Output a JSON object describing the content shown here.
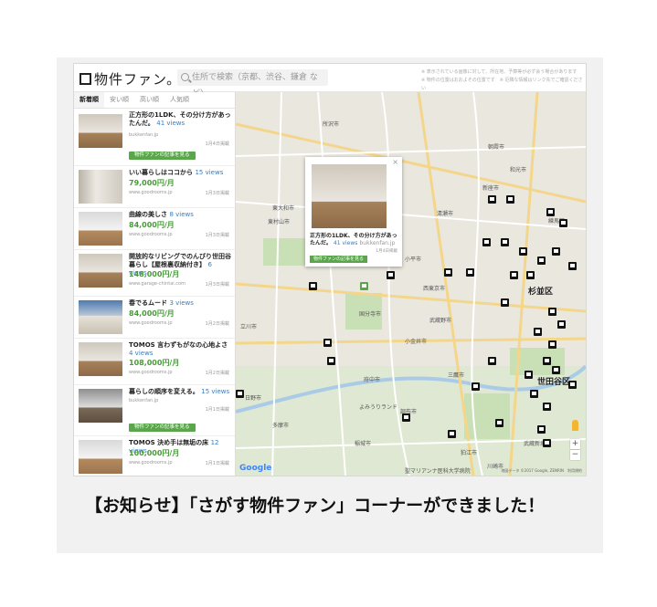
{
  "app": {
    "logo_text": "物件ファン。",
    "search_placeholder": "住所で検索（京都、渋谷、鎌倉 など）",
    "notes": [
      "※ 表示されている画像に対して、所在地、予算等が必ず会う場合があります",
      "※ 物件の位置はおおよその位置です　※ 近隣な情報はリンク先でご確認ください"
    ]
  },
  "sidebar": {
    "tabs": [
      {
        "label": "新着順",
        "active": true
      },
      {
        "label": "安い順",
        "active": false
      },
      {
        "label": "高い順",
        "active": false
      },
      {
        "label": "人気順",
        "active": false
      }
    ],
    "items": [
      {
        "title": "正方形の1LDK、その分け方があったんだ。",
        "views": "41 views",
        "price": "",
        "source": "bukkenfan.jp",
        "date": "1月4日掲載",
        "cta": "物件ファンの記事を見る"
      },
      {
        "title": "いい暮らしはココから",
        "views": "15 views",
        "price": "79,000円/月",
        "source": "www.goodrooms.jp",
        "date": "1月3日掲載",
        "cta": ""
      },
      {
        "title": "曲線の美しさ",
        "views": "8 views",
        "price": "84,000円/月",
        "source": "www.goodrooms.jp",
        "date": "1月3日掲載",
        "cta": ""
      },
      {
        "title": "開放的なリビングでのんびり世田谷暮らし【屋根裏収納付き】",
        "views": "6 views",
        "price": "148,000円/月",
        "source": "www.garage-chintai.com",
        "date": "1月3日掲載",
        "cta": ""
      },
      {
        "title": "春でるムード",
        "views": "3 views",
        "price": "84,000円/月",
        "source": "www.goodrooms.jp",
        "date": "1月2日掲載",
        "cta": ""
      },
      {
        "title": "TOMOS 言わずもがなの心地よさ",
        "views": "4 views",
        "price": "108,000円/月",
        "source": "www.goodrooms.jp",
        "date": "1月2日掲載",
        "cta": ""
      },
      {
        "title": "暮らしの順序を変える。",
        "views": "15 views",
        "price": "",
        "source": "bukkenfan.jp",
        "date": "1月1日掲載",
        "cta": "物件ファンの記事を見る"
      },
      {
        "title": "TOMOS 決め手は無垢の床",
        "views": "12 views",
        "price": "100,000円/月",
        "source": "www.goodrooms.jp",
        "date": "1月1日掲載",
        "cta": ""
      }
    ]
  },
  "map": {
    "labels": [
      "所沢市",
      "東大和市",
      "東村山市",
      "小平市",
      "西東京市",
      "武蔵野市",
      "三鷹市",
      "立川市",
      "府中市",
      "調布市",
      "多摩市",
      "狛江市",
      "川崎市",
      "武蔵新城",
      "和光市",
      "朝霞市",
      "清瀬市",
      "国分寺市",
      "小金井市",
      "日野市",
      "稲城市",
      "よみうりランド",
      "聖マリアンナ医科大学病院",
      "新座市",
      "練馬区"
    ],
    "big_labels": [
      "杉並区",
      "世田谷区"
    ],
    "popup": {
      "title": "正方形の1LDK、その分け方があったんだ。",
      "views": "41 views",
      "source": "bukkenfan.jp",
      "date": "1月4日掲載",
      "cta": "物件ファンの記事を見る",
      "close": "×"
    },
    "zoom_in": "+",
    "zoom_out": "−",
    "google": "Google",
    "attribution": "地図データ ©2017 Google, ZENRIN　利用規約"
  },
  "announcement": "【お知らせ】「さがす物件ファン」コーナーができました！"
}
